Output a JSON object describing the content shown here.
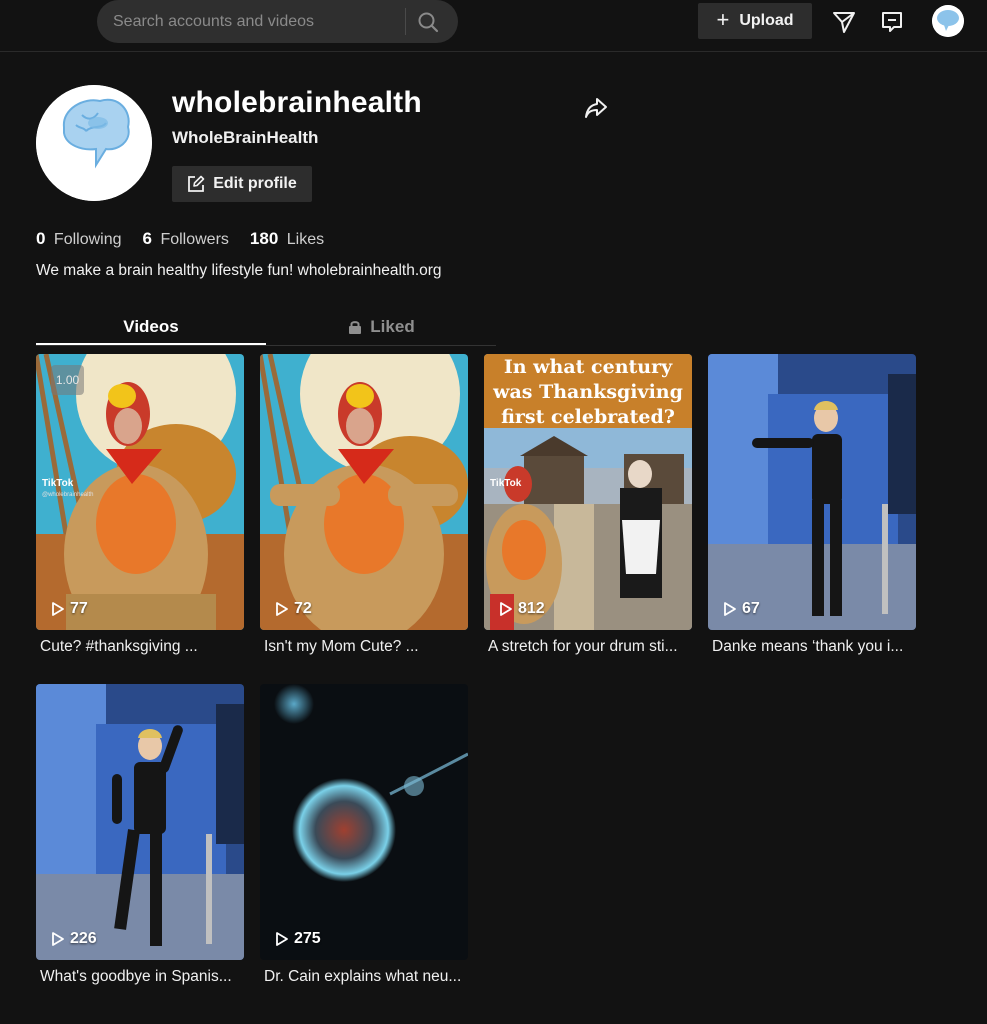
{
  "header": {
    "search_placeholder": "Search accounts and videos",
    "upload_label": "Upload"
  },
  "profile": {
    "username": "wholebrainhealth",
    "nickname": "WholeBrainHealth",
    "edit_label": "Edit profile",
    "stats": {
      "following_count": "0",
      "following_label": "Following",
      "followers_count": "6",
      "followers_label": "Followers",
      "likes_count": "180",
      "likes_label": "Likes"
    },
    "bio": "We make a brain healthy lifestyle fun! wholebrainhealth.org"
  },
  "tabs": {
    "videos": "Videos",
    "liked": "Liked"
  },
  "videos": [
    {
      "views": "77",
      "caption": "Cute? #thanksgiving ...",
      "badge": "1.00",
      "tiktok": "TikTok",
      "handle": "@wholebrainhealth"
    },
    {
      "views": "72",
      "caption": "Isn't my Mom Cute? ..."
    },
    {
      "views": "812",
      "caption": "A stretch for your drum sti...",
      "title": "In what century was Thanksgiving first celebrated?",
      "tiktok": "TikTok"
    },
    {
      "views": "67",
      "caption": "Danke means ‘thank you i..."
    },
    {
      "views": "226",
      "caption": "What's goodbye in Spanis..."
    },
    {
      "views": "275",
      "caption": "Dr. Cain explains what neu..."
    }
  ],
  "colors": {
    "background": "#121212",
    "surface": "#2d2d2d",
    "muted_text": "#8f8f8f"
  }
}
